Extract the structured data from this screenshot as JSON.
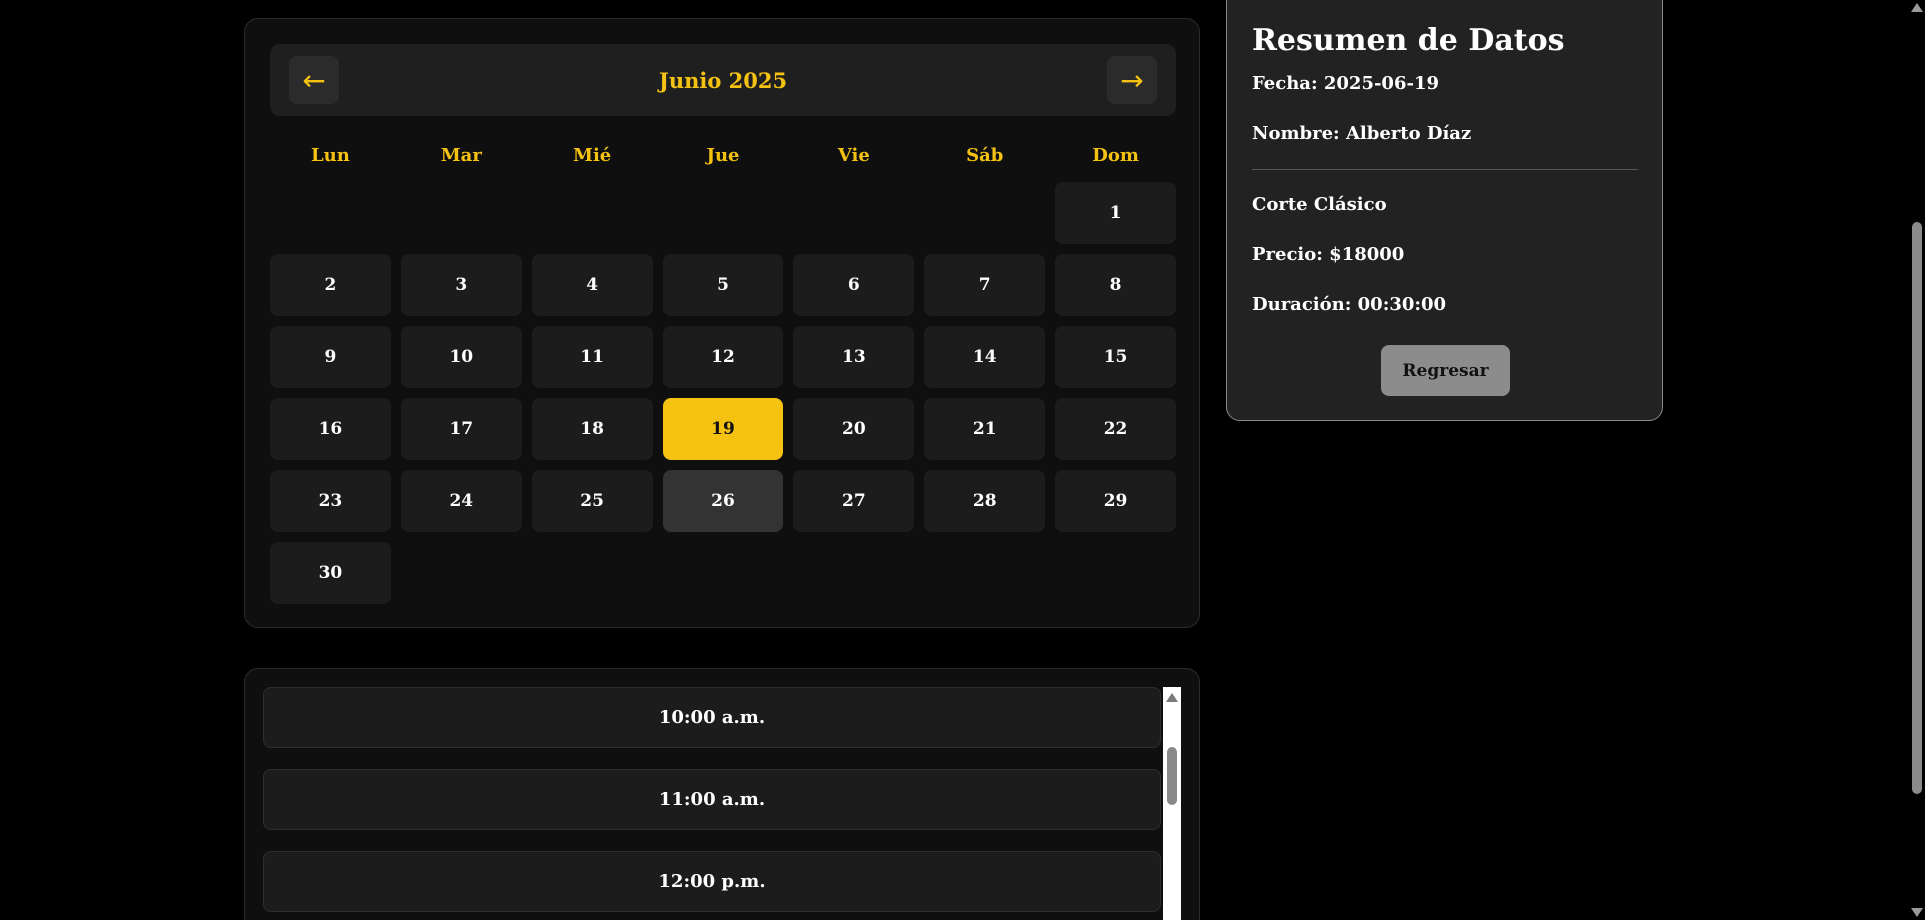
{
  "calendar": {
    "prev_icon": "←",
    "next_icon": "→",
    "month_title": "Junio 2025",
    "weekdays": [
      "Lun",
      "Mar",
      "Mié",
      "Jue",
      "Vie",
      "Sáb",
      "Dom"
    ],
    "days": [
      "1",
      "2",
      "3",
      "4",
      "5",
      "6",
      "7",
      "8",
      "9",
      "10",
      "11",
      "12",
      "13",
      "14",
      "15",
      "16",
      "17",
      "18",
      "19",
      "20",
      "21",
      "22",
      "23",
      "24",
      "25",
      "26",
      "27",
      "28",
      "29",
      "30"
    ],
    "selected_day": "19",
    "hovered_day": "26",
    "accent_color": "#f5c211"
  },
  "slots": {
    "times": [
      "10:00 a.m.",
      "11:00 a.m.",
      "12:00 p.m."
    ]
  },
  "summary": {
    "title": "Resumen de Datos",
    "date_line": "Fecha: 2025-06-19",
    "name_line": "Nombre: Alberto Díaz",
    "service": "Corte Clásico",
    "price_line": "Precio: $18000",
    "duration_line": "Duración: 00:30:00",
    "back_label": "Regresar"
  }
}
